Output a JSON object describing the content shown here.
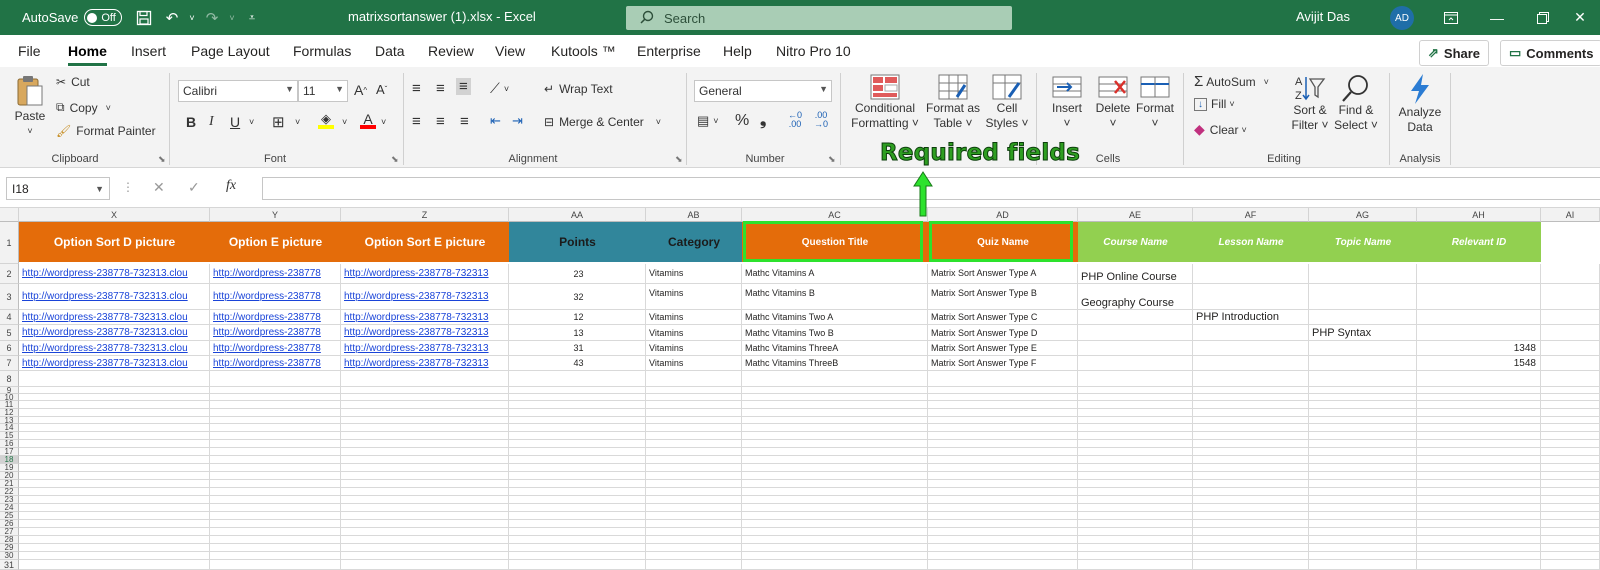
{
  "titlebar": {
    "autosave_label": "AutoSave",
    "autosave_state": "Off",
    "filename": "matrixsortanswer (1).xlsx  -  Excel",
    "search_placeholder": "Search",
    "user_name": "Avijit Das",
    "user_initials": "AD"
  },
  "menu": {
    "tabs": [
      "File",
      "Home",
      "Insert",
      "Page Layout",
      "Formulas",
      "Data",
      "Review",
      "View",
      "Kutools ™",
      "Enterprise",
      "Help",
      "Nitro Pro 10"
    ],
    "active": "Home",
    "share": "Share",
    "comments": "Comments"
  },
  "ribbon": {
    "clipboard": {
      "paste": "Paste",
      "cut": "Cut",
      "copy": "Copy",
      "format_painter": "Format Painter",
      "label": "Clipboard"
    },
    "font": {
      "name": "Calibri",
      "size": "11",
      "label": "Font"
    },
    "alignment": {
      "wrap": "Wrap Text",
      "merge": "Merge & Center",
      "label": "Alignment"
    },
    "number": {
      "format": "General",
      "label": "Number"
    },
    "styles": {
      "conditional": "Conditional",
      "conditional2": "Formatting",
      "format_as": "Format as",
      "format_as2": "Table",
      "cell_styles": "Cell",
      "cell_styles2": "Styles"
    },
    "cells": {
      "insert": "Insert",
      "delete": "Delete",
      "format": "Format",
      "label": "Cells"
    },
    "editing": {
      "autosum": "AutoSum",
      "fill": "Fill",
      "clear": "Clear",
      "sort": "Sort &",
      "sort2": "Filter",
      "find": "Find &",
      "find2": "Select",
      "label": "Editing"
    },
    "analysis": {
      "analyze": "Analyze",
      "analyze2": "Data",
      "label": "Analysis"
    }
  },
  "formula_bar": {
    "name_box": "I18",
    "fx": "fx",
    "value": ""
  },
  "annotation": "Required fields",
  "columns": [
    "X",
    "Y",
    "Z",
    "AA",
    "AB",
    "AC",
    "AD",
    "AE",
    "AF",
    "AG",
    "AH",
    "AI"
  ],
  "header_row": [
    "Option Sort D picture",
    "Option E picture",
    "Option Sort E picture",
    "Points",
    "Category",
    "Question Title",
    "Quiz Name",
    "Course Name",
    "Lesson Name",
    "Topic Name",
    "Relevant ID"
  ],
  "rows": [
    {
      "x": "http://wordpress-238778-732313.clou",
      "y": "http://wordpress-238778",
      "z": "http://wordpress-238778-732313",
      "points": "23",
      "category": "Vitamins",
      "title": "Mathc Vitamins A",
      "quiz": "Matrix Sort Answer Type A",
      "course": "PHP Online Course",
      "lesson": "",
      "topic": "",
      "id": ""
    },
    {
      "x": "http://wordpress-238778-732313.clou",
      "y": "http://wordpress-238778",
      "z": "http://wordpress-238778-732313",
      "points": "32",
      "category": "Vitamins",
      "title": "Mathc Vitamins B",
      "quiz": "Matrix Sort Answer Type B",
      "course": "Geography Course",
      "lesson": "",
      "topic": "",
      "id": ""
    },
    {
      "x": "http://wordpress-238778-732313.clou",
      "y": "http://wordpress-238778",
      "z": "http://wordpress-238778-732313",
      "points": "12",
      "category": "Vitamins",
      "title": "Mathc Vitamins Two A",
      "quiz": "Matrix Sort Answer Type C",
      "course": "",
      "lesson": "PHP Introduction",
      "topic": "",
      "id": ""
    },
    {
      "x": "http://wordpress-238778-732313.clou",
      "y": "http://wordpress-238778",
      "z": "http://wordpress-238778-732313",
      "points": "13",
      "category": "Vitamins",
      "title": "Mathc Vitamins Two B",
      "quiz": "Matrix Sort Answer Type D",
      "course": "",
      "lesson": "",
      "topic": "PHP Syntax",
      "id": ""
    },
    {
      "x": "http://wordpress-238778-732313.clou",
      "y": "http://wordpress-238778",
      "z": "http://wordpress-238778-732313",
      "points": "31",
      "category": "Vitamins",
      "title": "Mathc Vitamins ThreeA",
      "quiz": "Matrix Sort Answer Type E",
      "course": "",
      "lesson": "",
      "topic": "",
      "id": "1348"
    },
    {
      "x": "http://wordpress-238778-732313.clou",
      "y": "http://wordpress-238778",
      "z": "http://wordpress-238778-732313",
      "points": "43",
      "category": "Vitamins",
      "title": "Mathc Vitamins ThreeB",
      "quiz": "Matrix Sort Answer Type F",
      "course": "",
      "lesson": "",
      "topic": "",
      "id": "1548"
    }
  ],
  "colors": {
    "excel_green": "#217346",
    "orange_header": "#e46c0a",
    "teal_header": "#31869b",
    "green_header": "#92d050",
    "highlight": "#2de22d"
  }
}
